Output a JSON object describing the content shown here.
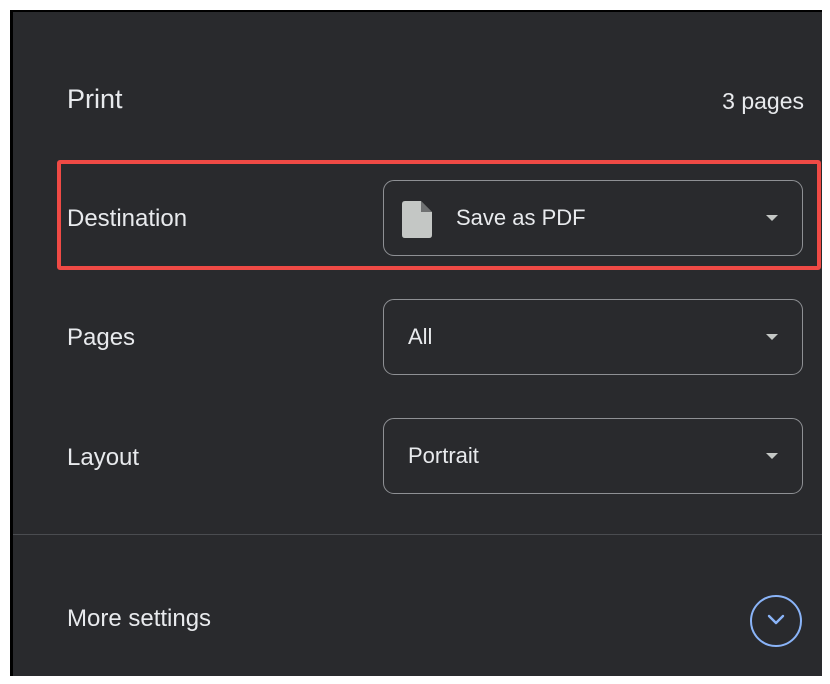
{
  "print": {
    "title": "Print",
    "page_count": "3 pages"
  },
  "settings": [
    {
      "label": "Destination",
      "value": "Save as PDF",
      "icon": "file-icon"
    },
    {
      "label": "Pages",
      "value": "All"
    },
    {
      "label": "Layout",
      "value": "Portrait"
    }
  ],
  "more_settings": {
    "label": "More settings",
    "icon": "chevron-down-icon"
  },
  "colors": {
    "panel_background": "#292a2d",
    "text": "#e8eaed",
    "highlight": "#ef4a45",
    "accent": "#8ab4f8"
  }
}
